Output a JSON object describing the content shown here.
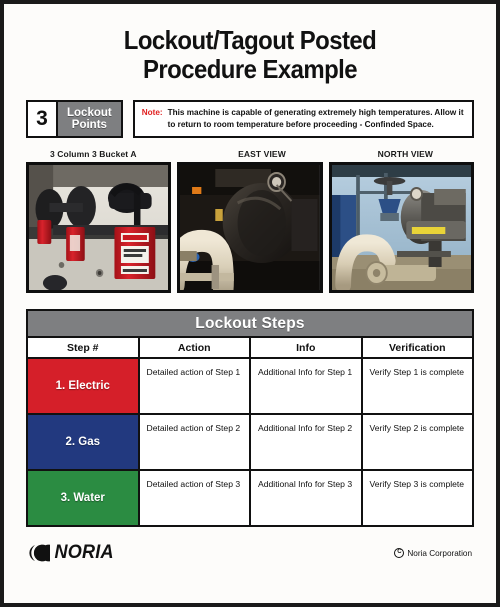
{
  "document": {
    "title_line_1": "Lockout/Tagout Posted",
    "title_line_2": "Procedure Example"
  },
  "lockout_points": {
    "count": "3",
    "label_line_1": "Lockout",
    "label_line_2": "Points"
  },
  "note": {
    "label": "Note:",
    "text": "This machine is capable of generating extremely high temperatures. Allow it to return to room temperature before proceeding - Confinded Space."
  },
  "photos": [
    {
      "caption": "3 Column 3 Bucket A",
      "alt": "Red safety padlocks and a DANGER LOCKED OUT DO NOT REMOVE tag installed on machine valve handles"
    },
    {
      "caption": "EAST VIEW",
      "alt": "East view of a large dark industrial blower or compressor with a cream colored elbow pipe in the foreground"
    },
    {
      "caption": "NORTH VIEW",
      "alt": "North view of outdoor pump skid with gate valves, piping and a yellow equipment label"
    }
  ],
  "table": {
    "title": "Lockout Steps",
    "columns": [
      "Step #",
      "Action",
      "Info",
      "Verification"
    ],
    "rows": [
      {
        "step": "1. Electric",
        "color": "#d51f29",
        "action": "Detailed action of Step 1",
        "info": "Additional Info for Step 1",
        "verification": "Verify Step 1 is complete"
      },
      {
        "step": "2. Gas",
        "color": "#22397f",
        "action": "Detailed action of Step 2",
        "info": "Additional Info for Step 2",
        "verification": "Verify Step 2 is complete"
      },
      {
        "step": "3. Water",
        "color": "#2b8c42",
        "action": "Detailed action of Step 3",
        "info": "Additional Info for Step 3",
        "verification": "Verify Step 3 is complete"
      }
    ]
  },
  "footer": {
    "logo_text": "NORIA",
    "copyright": "Noria Corporation"
  },
  "colors": {
    "frame": "#1a1a1a",
    "gray_header": "#7e7f81",
    "note_red": "#e02020",
    "step_1": "#d51f29",
    "step_2": "#22397f",
    "step_3": "#2b8c42"
  }
}
